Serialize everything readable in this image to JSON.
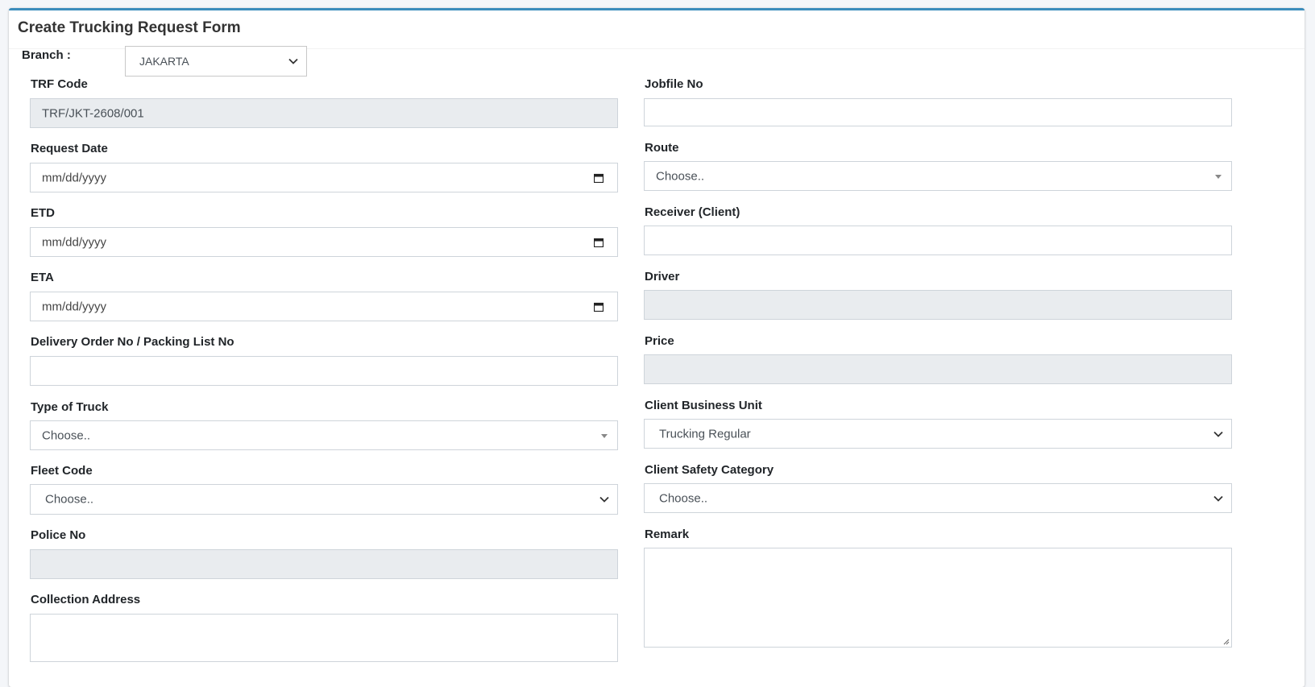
{
  "form": {
    "title": "Create Trucking Request Form",
    "branch": {
      "label": "Branch :",
      "value": "JAKARTA"
    },
    "left": {
      "trf_code": {
        "label": "TRF Code",
        "value": "TRF/JKT-2608/001"
      },
      "request_date": {
        "label": "Request Date",
        "placeholder": "mm/dd/yyyy"
      },
      "etd": {
        "label": "ETD",
        "placeholder": "mm/dd/yyyy"
      },
      "eta": {
        "label": "ETA",
        "placeholder": "mm/dd/yyyy"
      },
      "delivery_order": {
        "label": "Delivery Order No / Packing List No",
        "value": ""
      },
      "type_of_truck": {
        "label": "Type of Truck",
        "value": "Choose.."
      },
      "fleet_code": {
        "label": "Fleet Code",
        "value": "Choose.."
      },
      "police_no": {
        "label": "Police No",
        "value": ""
      },
      "collection_address": {
        "label": "Collection Address",
        "value": ""
      }
    },
    "right": {
      "jobfile_no": {
        "label": "Jobfile No",
        "value": ""
      },
      "route": {
        "label": "Route",
        "value": "Choose.."
      },
      "receiver": {
        "label": "Receiver (Client)",
        "value": ""
      },
      "driver": {
        "label": "Driver",
        "value": ""
      },
      "price": {
        "label": "Price",
        "value": ""
      },
      "client_business_unit": {
        "label": "Client Business Unit",
        "value": "Trucking Regular"
      },
      "client_safety_category": {
        "label": "Client Safety Category",
        "value": "Choose.."
      },
      "remark": {
        "label": "Remark",
        "value": ""
      }
    }
  },
  "colors": {
    "accent": "#3c8dbc",
    "readonly_bg": "#e9ecef",
    "border": "#ced4da"
  },
  "icons": {
    "date": "calendar-icon",
    "select": "chevron-down-icon",
    "select2": "caret-down-icon"
  }
}
